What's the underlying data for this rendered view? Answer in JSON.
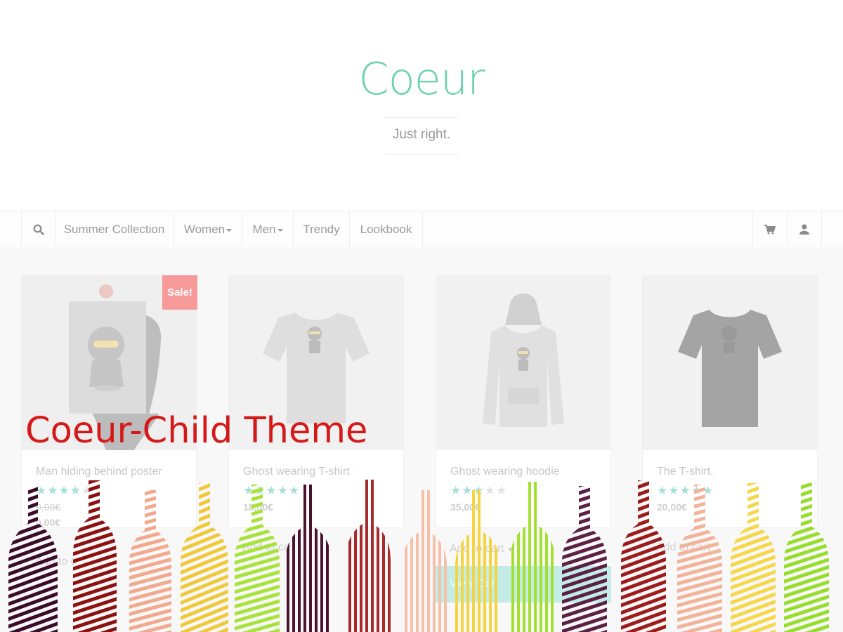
{
  "header": {
    "site_title": "Coeur",
    "tagline": "Just right."
  },
  "nav": {
    "search_icon": "search-icon",
    "items": [
      {
        "label": "Summer Collection",
        "dropdown": false
      },
      {
        "label": "Women",
        "dropdown": true
      },
      {
        "label": "Men",
        "dropdown": true
      },
      {
        "label": "Trendy",
        "dropdown": false
      },
      {
        "label": "Lookbook",
        "dropdown": false
      }
    ],
    "cart_icon": "cart-icon",
    "account_icon": "user-icon"
  },
  "products": [
    {
      "title": "Man hiding behind poster",
      "rating": 4,
      "old_price": "0,00€",
      "price": "0,00€",
      "badge": "Sale!",
      "cart_label": "Add to c"
    },
    {
      "title": "Ghost wearing T-shirt",
      "rating": 5,
      "price": "18,00€",
      "cart_label": "Add to ca"
    },
    {
      "title": "Ghost wearing hoodie",
      "rating": 3,
      "price": "35,00€",
      "cart_label": "Add to cart",
      "view_cart": "View Cart"
    },
    {
      "title": "The T-shirt.",
      "rating": 5,
      "price": "20,00€",
      "cart_label": "Add to cart"
    }
  ],
  "overlay": {
    "child_title": "Coeur-Child Theme"
  },
  "colors": {
    "accent": "#6fd1b2",
    "sale": "#f69a9a",
    "child_title": "#d41919",
    "bottles": [
      "#3a0c2a",
      "#8c1212",
      "#f2a98e",
      "#f0c93a",
      "#a7e33a",
      "#4a1430",
      "#a82a2a",
      "#f6c0a8",
      "#f4d53f",
      "#a4e030",
      "#5a2045",
      "#9c1c1c",
      "#f3b39a",
      "#f7d74a",
      "#96dd2c"
    ]
  }
}
